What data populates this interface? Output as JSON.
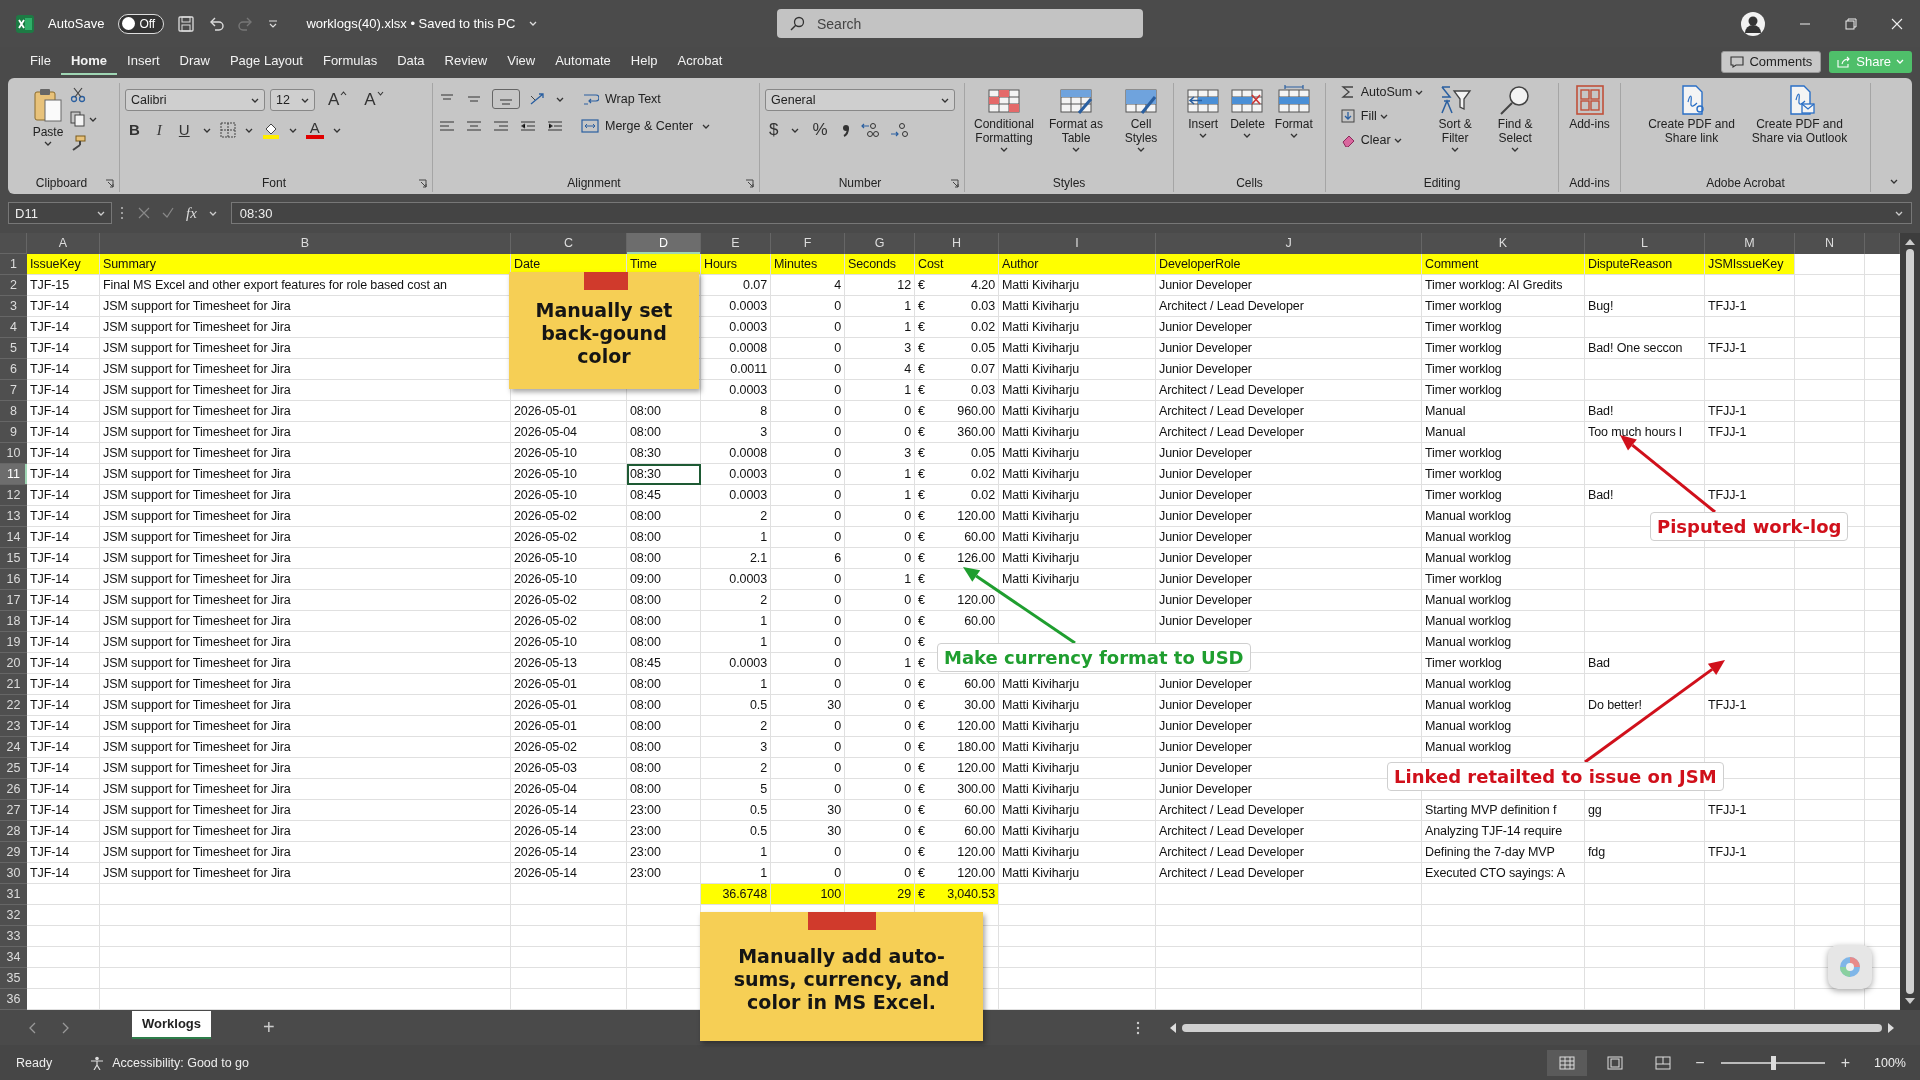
{
  "title_bar": {
    "autosave_label": "AutoSave",
    "autosave": {
      "on": false,
      "label": "Off"
    },
    "redo": {
      "disabled": true
    },
    "document_title": "worklogs(40).xlsx • Saved to this PC",
    "search": {
      "placeholder": "Search"
    }
  },
  "menu_tabs": [
    {
      "label": "File",
      "selected": false
    },
    {
      "label": "Home",
      "selected": true
    },
    {
      "label": "Insert",
      "selected": false
    },
    {
      "label": "Draw",
      "selected": false
    },
    {
      "label": "Page Layout",
      "selected": false
    },
    {
      "label": "Formulas",
      "selected": false
    },
    {
      "label": "Data",
      "selected": false
    },
    {
      "label": "Review",
      "selected": false
    },
    {
      "label": "View",
      "selected": false
    },
    {
      "label": "Automate",
      "selected": false
    },
    {
      "label": "Help",
      "selected": false
    },
    {
      "label": "Acrobat",
      "selected": false
    }
  ],
  "menu_buttons": [
    {
      "label": "Comments",
      "kind": "plain"
    },
    {
      "label": "Share",
      "kind": "primary"
    }
  ],
  "ribbon": {
    "groups": [
      {
        "kind": "clipboard",
        "label": "Clipboard",
        "paste": "Paste"
      },
      {
        "kind": "font",
        "label": "Font",
        "font": "Calibri",
        "size": "12",
        "grow": "A",
        "shrink": "A",
        "bold": "B",
        "italic": "I",
        "underline": "U",
        "font_color": "A"
      },
      {
        "kind": "alignment",
        "label": "Alignment",
        "wrap": "Wrap Text",
        "merge": "Merge & Center"
      },
      {
        "kind": "number",
        "label": "Number",
        "format": "General",
        "currency": "$",
        "percent": "%"
      },
      {
        "kind": "styles",
        "label": "Styles",
        "buttons": [
          "Conditional Formatting",
          "Format as Table",
          "Cell Styles"
        ]
      },
      {
        "kind": "cells",
        "label": "Cells",
        "buttons": [
          "Insert",
          "Delete",
          "Format"
        ]
      },
      {
        "kind": "editing",
        "label": "Editing",
        "small": [
          "AutoSum",
          "Fill",
          "Clear"
        ],
        "buttons": [
          "Sort & Filter",
          "Find & Select"
        ]
      },
      {
        "kind": "addins",
        "label": "Add-ins",
        "buttons": [
          "Add-ins"
        ]
      },
      {
        "kind": "acrobat",
        "label": "Adobe Acrobat",
        "buttons": [
          "Create PDF and Share link",
          "Create PDF and Share via Outlook"
        ]
      }
    ]
  },
  "formula_bar": {
    "name_box": "D11",
    "function_label": "fx",
    "value": "08:30"
  },
  "columns": [
    {
      "label": "A",
      "selected": false
    },
    {
      "label": "B",
      "selected": false
    },
    {
      "label": "C",
      "selected": false
    },
    {
      "label": "D",
      "selected": true
    },
    {
      "label": "E",
      "selected": false
    },
    {
      "label": "F",
      "selected": false
    },
    {
      "label": "G",
      "selected": false
    },
    {
      "label": "H",
      "selected": false
    },
    {
      "label": "I",
      "selected": false
    },
    {
      "label": "J",
      "selected": false
    },
    {
      "label": "K",
      "selected": false
    },
    {
      "label": "L",
      "selected": false
    },
    {
      "label": "M",
      "selected": false
    },
    {
      "label": "N",
      "selected": false
    }
  ],
  "header_row": {
    "number": "1",
    "highlighted": true,
    "selected": false,
    "cells": [
      "IssueKey",
      "Summary",
      "Date",
      "Time",
      "Hours",
      "Minutes",
      "Seconds",
      "Cost",
      "Author",
      "DeveloperRole",
      "Comment",
      "DisputeReason",
      "JSMIssueKey"
    ]
  },
  "rows": [
    {
      "number": "2",
      "highlighted": false,
      "selected": false,
      "key": "TJF-15",
      "summary": "Final MS Excel and other export features for role based cost an",
      "hours": "0.07",
      "minutes": "4",
      "seconds": "12",
      "currency": "€",
      "cost": "4.20",
      "author": "Matti Kiviharju",
      "role": "Junior Developer",
      "comment": "Timer worklog: AI Gredits"
    },
    {
      "number": "3",
      "highlighted": false,
      "selected": false,
      "key": "TJF-14",
      "summary": "JSM support for Timesheet for Jira",
      "hours": "0.0003",
      "minutes": "0",
      "seconds": "1",
      "currency": "€",
      "cost": "0.03",
      "author": "Matti Kiviharju",
      "role": "Architect / Lead Developer",
      "comment": "Timer worklog",
      "dispute": "Bug!",
      "jsm": "TFJJ-1"
    },
    {
      "number": "4",
      "highlighted": false,
      "selected": false,
      "key": "TJF-14",
      "summary": "JSM support for Timesheet for Jira",
      "hours": "0.0003",
      "minutes": "0",
      "seconds": "1",
      "currency": "€",
      "cost": "0.02",
      "author": "Matti Kiviharju",
      "role": "Junior Developer",
      "comment": "Timer worklog"
    },
    {
      "number": "5",
      "highlighted": false,
      "selected": false,
      "key": "TJF-14",
      "summary": "JSM support for Timesheet for Jira",
      "hours": "0.0008",
      "minutes": "0",
      "seconds": "3",
      "currency": "€",
      "cost": "0.05",
      "author": "Matti Kiviharju",
      "role": "Junior Developer",
      "comment": "Timer worklog",
      "dispute": "Bad! One seccon",
      "jsm": "TFJJ-1"
    },
    {
      "number": "6",
      "highlighted": false,
      "selected": false,
      "key": "TJF-14",
      "summary": "JSM support for Timesheet for Jira",
      "hours": "0.0011",
      "minutes": "0",
      "seconds": "4",
      "currency": "€",
      "cost": "0.07",
      "author": "Matti Kiviharju",
      "role": "Junior Developer",
      "comment": "Timer worklog"
    },
    {
      "number": "7",
      "highlighted": false,
      "selected": false,
      "key": "TJF-14",
      "summary": "JSM support for Timesheet for Jira",
      "hours": "0.0003",
      "minutes": "0",
      "seconds": "1",
      "currency": "€",
      "cost": "0.03",
      "author": "Matti Kiviharju",
      "role": "Architect / Lead Developer",
      "comment": "Timer worklog"
    },
    {
      "number": "8",
      "highlighted": false,
      "selected": false,
      "key": "TJF-14",
      "summary": "JSM support for Timesheet for Jira",
      "date": "2026-05-01",
      "time": "08:00",
      "hours": "8",
      "minutes": "0",
      "seconds": "0",
      "currency": "€",
      "cost": "960.00",
      "author": "Matti Kiviharju",
      "role": "Architect / Lead Developer",
      "comment": "Manual",
      "dispute": "Bad!",
      "jsm": "TFJJ-1"
    },
    {
      "number": "9",
      "highlighted": false,
      "selected": false,
      "key": "TJF-14",
      "summary": "JSM support for Timesheet for Jira",
      "date": "2026-05-04",
      "time": "08:00",
      "hours": "3",
      "minutes": "0",
      "seconds": "0",
      "currency": "€",
      "cost": "360.00",
      "author": "Matti Kiviharju",
      "role": "Architect / Lead Developer",
      "comment": "Manual",
      "dispute": "Too much hours l",
      "jsm": "TFJJ-1"
    },
    {
      "number": "10",
      "highlighted": false,
      "selected": false,
      "key": "TJF-14",
      "summary": "JSM support for Timesheet for Jira",
      "date": "2026-05-10",
      "time": "08:30",
      "hours": "0.0008",
      "minutes": "0",
      "seconds": "3",
      "currency": "€",
      "cost": "0.05",
      "author": "Matti Kiviharju",
      "role": "Junior Developer",
      "comment": "Timer worklog"
    },
    {
      "number": "11",
      "highlighted": false,
      "selected": true,
      "key": "TJF-14",
      "summary": "JSM support for Timesheet for Jira",
      "date": "2026-05-10",
      "time": "08:30",
      "hours": "0.0003",
      "minutes": "0",
      "seconds": "1",
      "currency": "€",
      "cost": "0.02",
      "author": "Matti Kiviharju",
      "role": "Junior Developer",
      "comment": "Timer worklog"
    },
    {
      "number": "12",
      "highlighted": false,
      "selected": false,
      "key": "TJF-14",
      "summary": "JSM support for Timesheet for Jira",
      "date": "2026-05-10",
      "time": "08:45",
      "hours": "0.0003",
      "minutes": "0",
      "seconds": "1",
      "currency": "€",
      "cost": "0.02",
      "author": "Matti Kiviharju",
      "role": "Junior Developer",
      "comment": "Timer worklog",
      "dispute": "Bad!",
      "jsm": "TFJJ-1"
    },
    {
      "number": "13",
      "highlighted": false,
      "selected": false,
      "key": "TJF-14",
      "summary": "JSM support for Timesheet for Jira",
      "date": "2026-05-02",
      "time": "08:00",
      "hours": "2",
      "minutes": "0",
      "seconds": "0",
      "currency": "€",
      "cost": "120.00",
      "author": "Matti Kiviharju",
      "role": "Junior Developer",
      "comment": "Manual worklog"
    },
    {
      "number": "14",
      "highlighted": false,
      "selected": false,
      "key": "TJF-14",
      "summary": "JSM support for Timesheet for Jira",
      "date": "2026-05-02",
      "time": "08:00",
      "hours": "1",
      "minutes": "0",
      "seconds": "0",
      "currency": "€",
      "cost": "60.00",
      "author": "Matti Kiviharju",
      "role": "Junior Developer",
      "comment": "Manual worklog"
    },
    {
      "number": "15",
      "highlighted": false,
      "selected": false,
      "key": "TJF-14",
      "summary": "JSM support for Timesheet for Jira",
      "date": "2026-05-10",
      "time": "08:00",
      "hours": "2.1",
      "minutes": "6",
      "seconds": "0",
      "currency": "€",
      "cost": "126.00",
      "author": "Matti Kiviharju",
      "role": "Junior Developer",
      "comment": "Manual worklog"
    },
    {
      "number": "16",
      "highlighted": false,
      "selected": false,
      "key": "TJF-14",
      "summary": "JSM support for Timesheet for Jira",
      "date": "2026-05-10",
      "time": "09:00",
      "hours": "0.0003",
      "minutes": "0",
      "seconds": "1",
      "currency": "€",
      "author": "Matti Kiviharju",
      "role": "Junior Developer",
      "comment": "Timer worklog"
    },
    {
      "number": "17",
      "highlighted": false,
      "selected": false,
      "key": "TJF-14",
      "summary": "JSM support for Timesheet for Jira",
      "date": "2026-05-02",
      "time": "08:00",
      "hours": "2",
      "minutes": "0",
      "seconds": "0",
      "currency": "€",
      "cost": "120.00",
      "role": "Junior Developer",
      "comment": "Manual worklog"
    },
    {
      "number": "18",
      "highlighted": false,
      "selected": false,
      "key": "TJF-14",
      "summary": "JSM support for Timesheet for Jira",
      "date": "2026-05-02",
      "time": "08:00",
      "hours": "1",
      "minutes": "0",
      "seconds": "0",
      "currency": "€",
      "cost": "60.00",
      "role": "Junior Developer",
      "comment": "Manual worklog"
    },
    {
      "number": "19",
      "highlighted": false,
      "selected": false,
      "key": "TJF-14",
      "summary": "JSM support for Timesheet for Jira",
      "date": "2026-05-10",
      "time": "08:00",
      "hours": "1",
      "minutes": "0",
      "seconds": "0",
      "currency": "€",
      "comment": "Manual worklog"
    },
    {
      "number": "20",
      "highlighted": false,
      "selected": false,
      "key": "TJF-14",
      "summary": "JSM support for Timesheet for Jira",
      "date": "2026-05-13",
      "time": "08:45",
      "hours": "0.0003",
      "minutes": "0",
      "seconds": "1",
      "currency": "€",
      "comment": "Timer worklog",
      "dispute": "Bad"
    },
    {
      "number": "21",
      "highlighted": false,
      "selected": false,
      "key": "TJF-14",
      "summary": "JSM support for Timesheet for Jira",
      "date": "2026-05-01",
      "time": "08:00",
      "hours": "1",
      "minutes": "0",
      "seconds": "0",
      "currency": "€",
      "cost": "60.00",
      "author": "Matti Kiviharju",
      "role": "Junior Developer",
      "comment": "Manual worklog"
    },
    {
      "number": "22",
      "highlighted": false,
      "selected": false,
      "key": "TJF-14",
      "summary": "JSM support for Timesheet for Jira",
      "date": "2026-05-01",
      "time": "08:00",
      "hours": "0.5",
      "minutes": "30",
      "seconds": "0",
      "currency": "€",
      "cost": "30.00",
      "author": "Matti Kiviharju",
      "role": "Junior Developer",
      "comment": "Manual worklog",
      "dispute": "Do better!",
      "jsm": "TFJJ-1"
    },
    {
      "number": "23",
      "highlighted": false,
      "selected": false,
      "key": "TJF-14",
      "summary": "JSM support for Timesheet for Jira",
      "date": "2026-05-01",
      "time": "08:00",
      "hours": "2",
      "minutes": "0",
      "seconds": "0",
      "currency": "€",
      "cost": "120.00",
      "author": "Matti Kiviharju",
      "role": "Junior Developer",
      "comment": "Manual worklog"
    },
    {
      "number": "24",
      "highlighted": false,
      "selected": false,
      "key": "TJF-14",
      "summary": "JSM support for Timesheet for Jira",
      "date": "2026-05-02",
      "time": "08:00",
      "hours": "3",
      "minutes": "0",
      "seconds": "0",
      "currency": "€",
      "cost": "180.00",
      "author": "Matti Kiviharju",
      "role": "Junior Developer",
      "comment": "Manual worklog"
    },
    {
      "number": "25",
      "highlighted": false,
      "selected": false,
      "key": "TJF-14",
      "summary": "JSM support for Timesheet for Jira",
      "date": "2026-05-03",
      "time": "08:00",
      "hours": "2",
      "minutes": "0",
      "seconds": "0",
      "currency": "€",
      "cost": "120.00",
      "author": "Matti Kiviharju",
      "role": "Junior Developer"
    },
    {
      "number": "26",
      "highlighted": false,
      "selected": false,
      "key": "TJF-14",
      "summary": "JSM support for Timesheet for Jira",
      "date": "2026-05-04",
      "time": "08:00",
      "hours": "5",
      "minutes": "0",
      "seconds": "0",
      "currency": "€",
      "cost": "300.00",
      "author": "Matti Kiviharju",
      "role": "Junior Developer"
    },
    {
      "number": "27",
      "highlighted": false,
      "selected": false,
      "key": "TJF-14",
      "summary": "JSM support for Timesheet for Jira",
      "date": "2026-05-14",
      "time": "23:00",
      "hours": "0.5",
      "minutes": "30",
      "seconds": "0",
      "currency": "€",
      "cost": "60.00",
      "author": "Matti Kiviharju",
      "role": "Architect / Lead Developer",
      "comment": "Starting MVP definition f",
      "dispute": "gg",
      "jsm": "TFJJ-1"
    },
    {
      "number": "28",
      "highlighted": false,
      "selected": false,
      "key": "TJF-14",
      "summary": "JSM support for Timesheet for Jira",
      "date": "2026-05-14",
      "time": "23:00",
      "hours": "0.5",
      "minutes": "30",
      "seconds": "0",
      "currency": "€",
      "cost": "60.00",
      "author": "Matti Kiviharju",
      "role": "Architect / Lead Developer",
      "comment": "Analyzing TJF-14 require"
    },
    {
      "number": "29",
      "highlighted": false,
      "selected": false,
      "key": "TJF-14",
      "summary": "JSM support for Timesheet for Jira",
      "date": "2026-05-14",
      "time": "23:00",
      "hours": "1",
      "minutes": "0",
      "seconds": "0",
      "currency": "€",
      "cost": "120.00",
      "author": "Matti Kiviharju",
      "role": "Architect / Lead Developer",
      "comment": "Defining the 7-day MVP",
      "dispute": "fdg",
      "jsm": "TFJJ-1"
    },
    {
      "number": "30",
      "highlighted": false,
      "selected": false,
      "key": "TJF-14",
      "summary": "JSM support for Timesheet for Jira",
      "date": "2026-05-14",
      "time": "23:00",
      "hours": "1",
      "minutes": "0",
      "seconds": "0",
      "currency": "€",
      "cost": "120.00",
      "author": "Matti Kiviharju",
      "role": "Architect / Lead Developer",
      "comment": "Executed CTO sayings: A"
    },
    {
      "number": "31",
      "highlighted": true,
      "selected": false,
      "hours": "36.6748",
      "minutes": "100",
      "seconds": "29",
      "currency": "€",
      "cost": "3,040.53"
    },
    {
      "number": "32",
      "highlighted": false,
      "selected": false
    },
    {
      "number": "33",
      "highlighted": false,
      "selected": false
    },
    {
      "number": "34",
      "highlighted": false,
      "selected": false
    },
    {
      "number": "35",
      "highlighted": false,
      "selected": false
    },
    {
      "number": "36",
      "highlighted": false,
      "selected": false
    }
  ],
  "annotations": [
    {
      "kind": "sticky-note",
      "text": "Manually set back-gound color"
    },
    {
      "kind": "callout",
      "text": "Pisputed work-log",
      "color": "#d0101b"
    },
    {
      "kind": "callout",
      "text": "Make currency format to USD",
      "color": "#1f9e2f"
    },
    {
      "kind": "callout",
      "text": "Linked retailted to issue on JSM",
      "color": "#d0101b"
    },
    {
      "kind": "sticky-note",
      "text": "Manually add auto-sums, currency, and color in MS Excel."
    }
  ],
  "sheet_tabs": [
    {
      "label": "Worklogs",
      "selected": true
    }
  ],
  "add_sheet": "+",
  "status_bar": {
    "status": "Ready",
    "accessibility": "Accessibility: Good to go",
    "zoom_out": "−",
    "zoom_in": "+",
    "zoom_slider": {
      "level": 0.5
    },
    "zoom": "100%"
  }
}
